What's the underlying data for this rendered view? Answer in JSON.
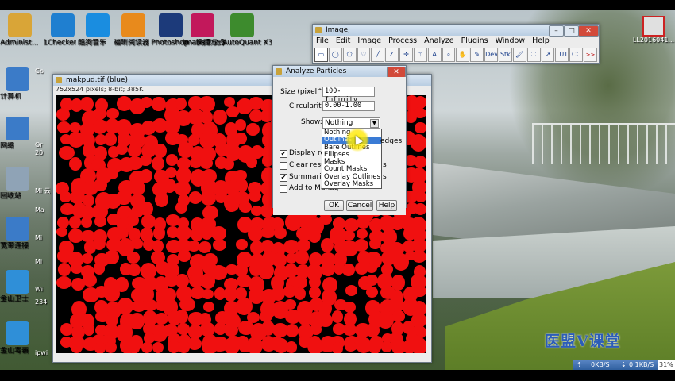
{
  "desktop": {
    "top_icons": [
      {
        "label": "Administ...",
        "icon": "folder-icon",
        "color": "#d9a537"
      },
      {
        "label": "1Checker",
        "icon": "checkmark-app-icon",
        "color": "#1f7fd0"
      },
      {
        "label": "酷狗音乐",
        "icon": "kugou-icon",
        "color": "#1a8de0"
      },
      {
        "label": "福昕阅读器",
        "icon": "foxit-reader-icon",
        "color": "#e88a1c"
      },
      {
        "label": "Photoshop - 快捷方式",
        "icon": "photoshop-icon",
        "color": "#1c3a7a"
      },
      {
        "label": "Imaris 7.2.3",
        "icon": "imaris-icon",
        "color": "#c2185b"
      },
      {
        "label": "AutoQuant X3",
        "icon": "autoquant-icon",
        "color": "#3d8b2d"
      }
    ],
    "left_icons": [
      {
        "label": "计算机",
        "icon": "computer-icon",
        "color": "#3b7bc8"
      },
      {
        "label": "网络",
        "icon": "network-icon",
        "color": "#3b7bc8"
      },
      {
        "label": "回收站",
        "icon": "recycle-bin-icon",
        "color": "#8fa3b6"
      },
      {
        "label": "宽带连接",
        "icon": "broadband-icon",
        "color": "#3b7bc8"
      },
      {
        "label": "金山卫士",
        "icon": "shield-icon",
        "color": "#2f8fd8"
      },
      {
        "label": "金山毒霸",
        "icon": "antivirus-icon",
        "color": "#2f8fd8"
      }
    ],
    "partial_icons": [
      "Go",
      "Or 20",
      "Mi 云",
      "Ma",
      "Mi",
      "Mi",
      "Wi",
      "234",
      "ipwi"
    ],
    "corner_icon_label": "LL2016041...",
    "watermark": "医盟V课堂",
    "tray": {
      "speed_up": "0KB/S",
      "speed_down": "0.1KB/S",
      "percent": "31%"
    }
  },
  "imagej": {
    "title": "ImageJ",
    "menu": [
      "File",
      "Edit",
      "Image",
      "Process",
      "Analyze",
      "Plugins",
      "Window",
      "Help"
    ],
    "tools": [
      {
        "name": "rectangle-tool-icon",
        "glyph": "▭"
      },
      {
        "name": "oval-tool-icon",
        "glyph": "◯"
      },
      {
        "name": "polygon-tool-icon",
        "glyph": "⬠"
      },
      {
        "name": "freehand-tool-icon",
        "glyph": "♡"
      },
      {
        "name": "line-tool-icon",
        "glyph": "╱"
      },
      {
        "name": "angle-tool-icon",
        "glyph": "∠"
      },
      {
        "name": "point-tool-icon",
        "glyph": "✛"
      },
      {
        "name": "wand-tool-icon",
        "glyph": "⚚"
      },
      {
        "name": "text-tool-icon",
        "glyph": "A"
      },
      {
        "name": "magnifier-tool-icon",
        "glyph": "⌕"
      },
      {
        "name": "hand-tool-icon",
        "glyph": "✋"
      },
      {
        "name": "dropper-tool-icon",
        "glyph": "✎"
      },
      {
        "name": "dev-tool-icon",
        "glyph": "Dev"
      },
      {
        "name": "stk-tool-icon",
        "glyph": "Stk"
      },
      {
        "name": "brush-tool-icon",
        "glyph": "🖌"
      },
      {
        "name": "fill-tool-icon",
        "glyph": "⛶"
      },
      {
        "name": "arrow-tool-icon",
        "glyph": "➚"
      },
      {
        "name": "lut-tool-icon",
        "glyph": "LUT"
      },
      {
        "name": "cc-tool-icon",
        "glyph": "CC"
      },
      {
        "name": "more-tools-icon",
        "glyph": ">>"
      }
    ]
  },
  "image_window": {
    "title": "makpud.tif (blue)",
    "info": "752x524 pixels; 8-bit; 385K",
    "blob_color": "#f01010"
  },
  "dialog": {
    "title": "Analyze Particles",
    "size_label": "Size (pixel^2):",
    "size_value": "100-Infinity",
    "circularity_label": "Circularity:",
    "circularity_value": "0.00-1.00",
    "show_label": "Show:",
    "show_value": "Nothing",
    "show_options": [
      "Nothing",
      "Outlines",
      "Bare Outlines",
      "Ellipses",
      "Masks",
      "Count Masks",
      "Overlay Outlines",
      "Overlay Masks"
    ],
    "highlighted_option": "Outlines",
    "checkboxes": [
      {
        "label": "Display resu",
        "checked": true
      },
      {
        "label": "Clear results",
        "checked": false
      },
      {
        "label": "Summarize",
        "checked": true
      },
      {
        "label": "Add to Manag",
        "checked": false
      }
    ],
    "right_fragments": [
      "edges",
      "s",
      "s"
    ],
    "ok": "OK",
    "cancel": "Cancel",
    "help": "Help"
  }
}
